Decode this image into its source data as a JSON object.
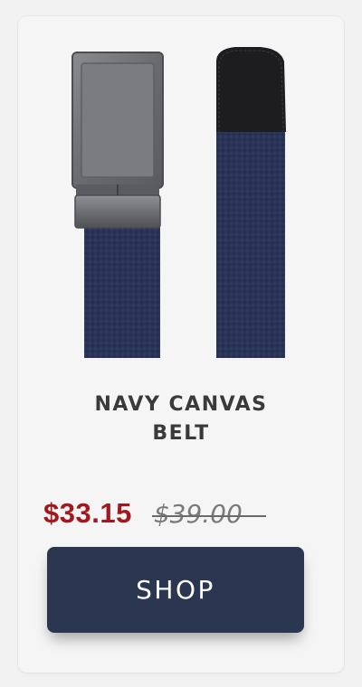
{
  "product": {
    "title_line1": "NAVY CANVAS",
    "title_line2": "BELT",
    "image_subject": "navy canvas belt with gunmetal ratchet buckle and black leather tip",
    "colors": {
      "belt": "#2a3458",
      "buckle": "#6e6f72",
      "tip": "#1d1d1f"
    }
  },
  "pricing": {
    "sale_price": "$33.15",
    "original_price": "$39.00",
    "sale_color": "#a3181c"
  },
  "actions": {
    "shop_label": "SHOP",
    "shop_color": "#2b3651"
  }
}
